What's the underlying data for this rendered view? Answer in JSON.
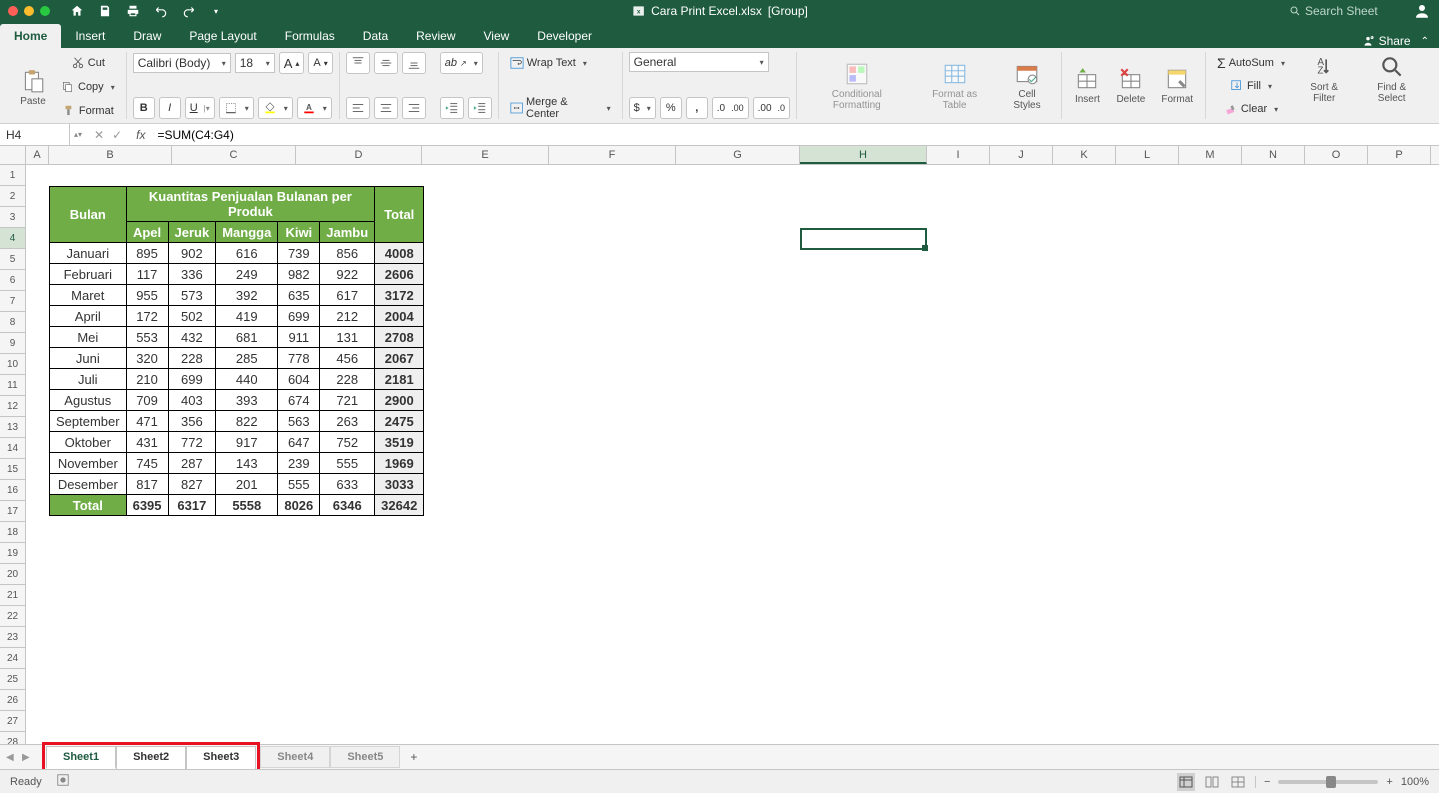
{
  "title": {
    "filename": "Cara Print Excel.xlsx",
    "suffix": "[Group]"
  },
  "search_placeholder": "Search Sheet",
  "tabs": [
    "Home",
    "Insert",
    "Draw",
    "Page Layout",
    "Formulas",
    "Data",
    "Review",
    "View",
    "Developer"
  ],
  "share_label": "Share",
  "clipboard": {
    "paste": "Paste",
    "cut": "Cut",
    "copy": "Copy",
    "format": "Format"
  },
  "font": {
    "name": "Calibri (Body)",
    "size": "18"
  },
  "alignment": {
    "wrap": "Wrap Text",
    "merge": "Merge & Center"
  },
  "number": {
    "format": "General"
  },
  "styles": {
    "cf": "Conditional Formatting",
    "fat": "Format as Table",
    "cs": "Cell Styles"
  },
  "cells": {
    "insert": "Insert",
    "delete": "Delete",
    "format": "Format"
  },
  "editing": {
    "autosum": "AutoSum",
    "fill": "Fill",
    "clear": "Clear",
    "sort": "Sort & Filter",
    "find": "Find & Select"
  },
  "name_box": "H4",
  "formula": "=SUM(C4:G4)",
  "columns": [
    "A",
    "B",
    "C",
    "D",
    "E",
    "F",
    "G",
    "H",
    "I",
    "J",
    "K",
    "L",
    "M",
    "N",
    "O",
    "P"
  ],
  "row_count": 29,
  "selected_col": "H",
  "selected_row": 4,
  "table": {
    "col_widths": {
      "B": 123,
      "C": 124,
      "D": 126,
      "E": 127,
      "F": 127,
      "G": 124,
      "H": 127
    },
    "header1": "Bulan",
    "header2": "Kuantitas Penjualan Bulanan per Produk",
    "header3": "Total",
    "products": [
      "Apel",
      "Jeruk",
      "Mangga",
      "Kiwi",
      "Jambu"
    ],
    "rows": [
      {
        "month": "Januari",
        "vals": [
          895,
          902,
          616,
          739,
          856
        ],
        "total": 4008
      },
      {
        "month": "Februari",
        "vals": [
          117,
          336,
          249,
          982,
          922
        ],
        "total": 2606
      },
      {
        "month": "Maret",
        "vals": [
          955,
          573,
          392,
          635,
          617
        ],
        "total": 3172
      },
      {
        "month": "April",
        "vals": [
          172,
          502,
          419,
          699,
          212
        ],
        "total": 2004
      },
      {
        "month": "Mei",
        "vals": [
          553,
          432,
          681,
          911,
          131
        ],
        "total": 2708
      },
      {
        "month": "Juni",
        "vals": [
          320,
          228,
          285,
          778,
          456
        ],
        "total": 2067
      },
      {
        "month": "Juli",
        "vals": [
          210,
          699,
          440,
          604,
          228
        ],
        "total": 2181
      },
      {
        "month": "Agustus",
        "vals": [
          709,
          403,
          393,
          674,
          721
        ],
        "total": 2900
      },
      {
        "month": "September",
        "vals": [
          471,
          356,
          822,
          563,
          263
        ],
        "total": 2475
      },
      {
        "month": "Oktober",
        "vals": [
          431,
          772,
          917,
          647,
          752
        ],
        "total": 3519
      },
      {
        "month": "November",
        "vals": [
          745,
          287,
          143,
          239,
          555
        ],
        "total": 1969
      },
      {
        "month": "Desember",
        "vals": [
          817,
          827,
          201,
          555,
          633
        ],
        "total": 3033
      }
    ],
    "totals": {
      "label": "Total",
      "vals": [
        6395,
        6317,
        5558,
        8026,
        6346
      ],
      "grand": 32642
    }
  },
  "sheets": [
    "Sheet1",
    "Sheet2",
    "Sheet3",
    "Sheet4",
    "Sheet5"
  ],
  "active_sheet": "Sheet1",
  "status": "Ready",
  "zoom": "100%"
}
